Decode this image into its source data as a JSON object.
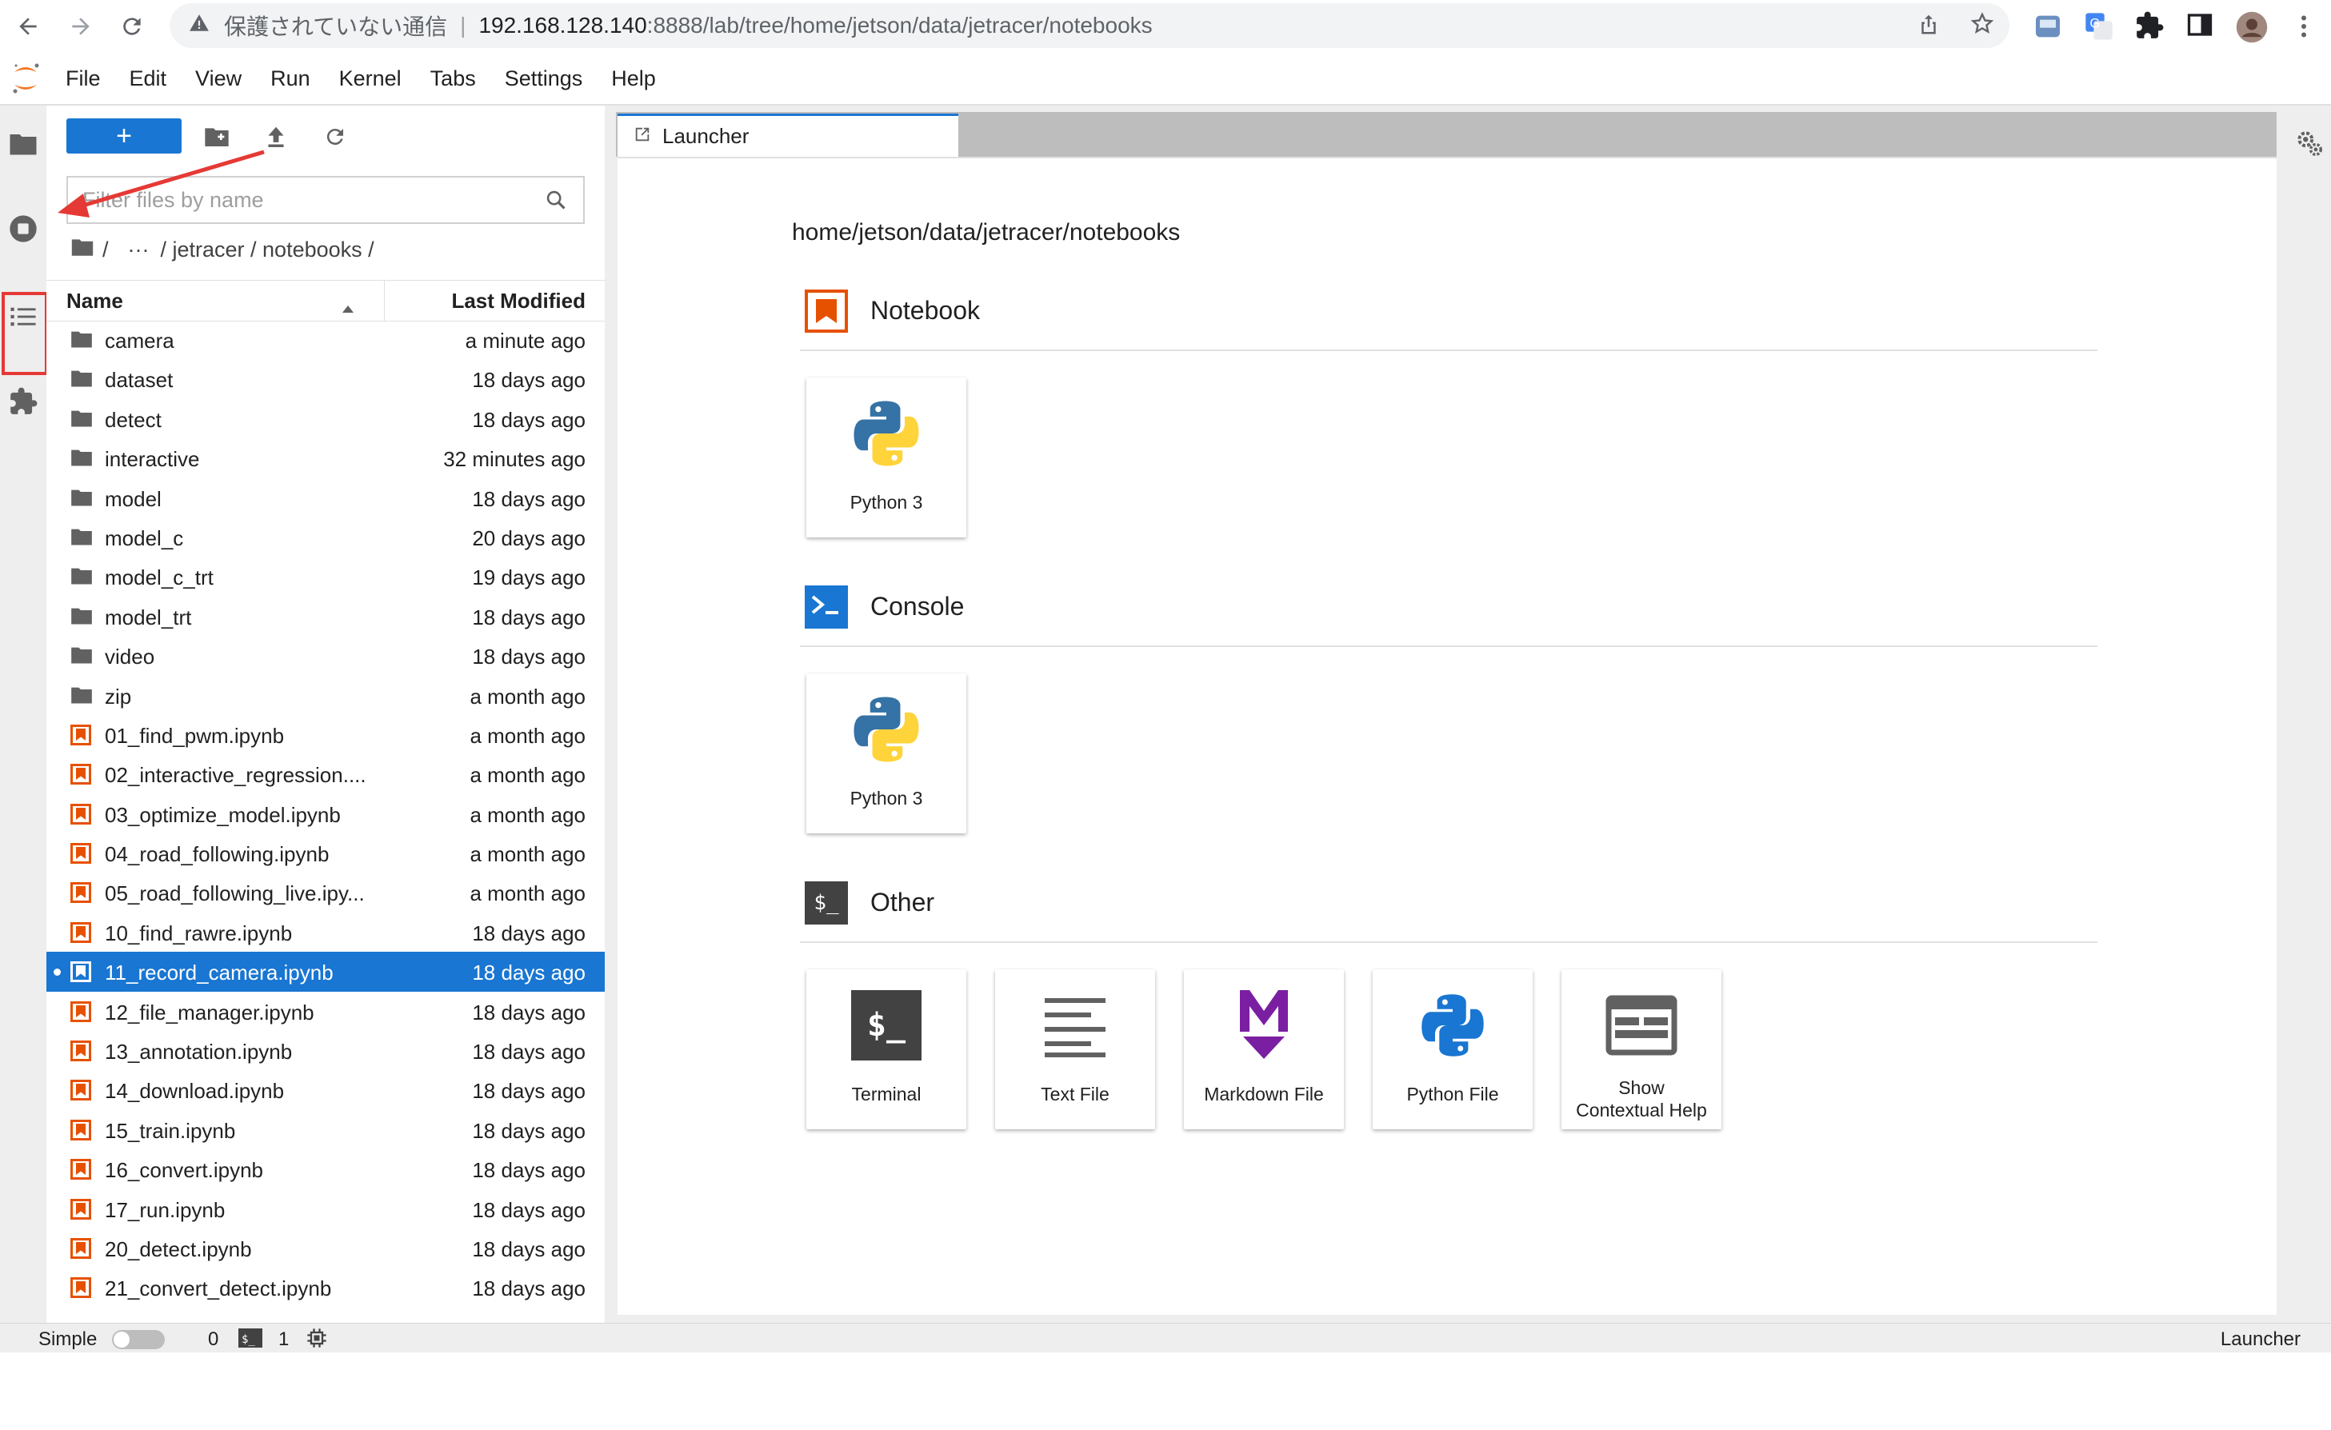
{
  "browser": {
    "insecure_label": "保護されていない通信",
    "url_host": "192.168.128.140",
    "url_path": ":8888/lab/tree/home/jetson/data/jetracer/notebooks"
  },
  "menu": [
    "File",
    "Edit",
    "View",
    "Run",
    "Kernel",
    "Tabs",
    "Settings",
    "Help"
  ],
  "filebrowser": {
    "new_label": "+",
    "filter_placeholder": "Filter files by name",
    "breadcrumb": {
      "root": "/",
      "ellipsis": "···",
      "path": "/ jetracer / notebooks /"
    },
    "columns": {
      "name": "Name",
      "modified": "Last Modified"
    },
    "items": [
      {
        "name": "camera",
        "type": "folder",
        "modified": "a minute ago"
      },
      {
        "name": "dataset",
        "type": "folder",
        "modified": "18 days ago"
      },
      {
        "name": "detect",
        "type": "folder",
        "modified": "18 days ago"
      },
      {
        "name": "interactive",
        "type": "folder",
        "modified": "32 minutes ago"
      },
      {
        "name": "model",
        "type": "folder",
        "modified": "18 days ago"
      },
      {
        "name": "model_c",
        "type": "folder",
        "modified": "20 days ago"
      },
      {
        "name": "model_c_trt",
        "type": "folder",
        "modified": "19 days ago"
      },
      {
        "name": "model_trt",
        "type": "folder",
        "modified": "18 days ago"
      },
      {
        "name": "video",
        "type": "folder",
        "modified": "18 days ago"
      },
      {
        "name": "zip",
        "type": "folder",
        "modified": "a month ago"
      },
      {
        "name": "01_find_pwm.ipynb",
        "type": "notebook",
        "modified": "a month ago"
      },
      {
        "name": "02_interactive_regression....",
        "type": "notebook",
        "modified": "a month ago"
      },
      {
        "name": "03_optimize_model.ipynb",
        "type": "notebook",
        "modified": "a month ago"
      },
      {
        "name": "04_road_following.ipynb",
        "type": "notebook",
        "modified": "a month ago"
      },
      {
        "name": "05_road_following_live.ipy...",
        "type": "notebook",
        "modified": "a month ago"
      },
      {
        "name": "10_find_rawre.ipynb",
        "type": "notebook",
        "modified": "18 days ago"
      },
      {
        "name": "11_record_camera.ipynb",
        "type": "notebook",
        "modified": "18 days ago",
        "selected": true
      },
      {
        "name": "12_file_manager.ipynb",
        "type": "notebook",
        "modified": "18 days ago"
      },
      {
        "name": "13_annotation.ipynb",
        "type": "notebook",
        "modified": "18 days ago"
      },
      {
        "name": "14_download.ipynb",
        "type": "notebook",
        "modified": "18 days ago"
      },
      {
        "name": "15_train.ipynb",
        "type": "notebook",
        "modified": "18 days ago"
      },
      {
        "name": "16_convert.ipynb",
        "type": "notebook",
        "modified": "18 days ago"
      },
      {
        "name": "17_run.ipynb",
        "type": "notebook",
        "modified": "18 days ago"
      },
      {
        "name": "20_detect.ipynb",
        "type": "notebook",
        "modified": "18 days ago"
      },
      {
        "name": "21_convert_detect.ipynb",
        "type": "notebook",
        "modified": "18 days ago"
      }
    ]
  },
  "launcher": {
    "tab_label": "Launcher",
    "cwd": "home/jetson/data/jetracer/notebooks",
    "sections": {
      "notebook": {
        "title": "Notebook",
        "cards": [
          "Python 3"
        ]
      },
      "console": {
        "title": "Console",
        "cards": [
          "Python 3"
        ]
      },
      "other": {
        "title": "Other",
        "icon_text": "$_",
        "cards": [
          "Terminal",
          "Text File",
          "Markdown File",
          "Python File",
          "Show",
          "Contextual Help"
        ]
      }
    }
  },
  "statusbar": {
    "mode": "Simple",
    "kernels": "0",
    "terminals": "1",
    "right": "Launcher"
  },
  "colors": {
    "brand_blue": "#1976d2",
    "notebook_orange": "#e65100",
    "console_blue": "#1976d2",
    "markdown_purple": "#7b1fa2",
    "annotation_red": "#e53935"
  }
}
